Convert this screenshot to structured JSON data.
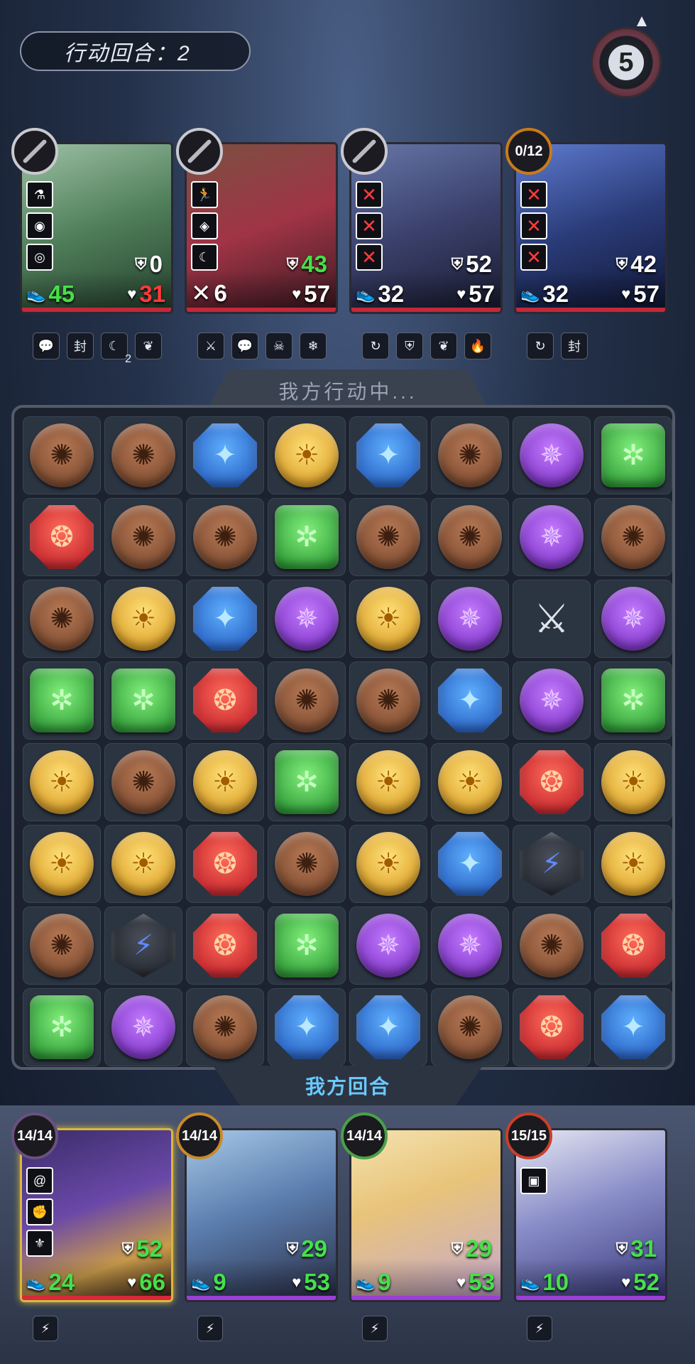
{
  "header": {
    "turn_label": "行动回合：2",
    "round_counter": "5"
  },
  "enemies": [
    {
      "badge": "",
      "speed": "45",
      "shield": "0",
      "hp": "31",
      "status_icons": [
        "flask-icon",
        "orb-icon",
        "target-icon"
      ],
      "skills": [
        "chat-icon",
        "seal-icon",
        "moon-icon",
        "leaf-icon"
      ],
      "skill_counter": "2"
    },
    {
      "badge": "",
      "speed": "6",
      "shield": "43",
      "hp": "57",
      "status_icons": [
        "runner-icon",
        "eye-icon",
        "crescent-icon"
      ],
      "skills": [
        "sword-icon",
        "chat-icon",
        "skull-icon",
        "snowflake-icon"
      ]
    },
    {
      "badge": "",
      "speed": "32",
      "shield": "52",
      "hp": "57",
      "status_icons": [
        "x-icon",
        "x-icon",
        "x-icon"
      ],
      "skills": [
        "cycle-icon",
        "shield-icon",
        "leaf-icon",
        "flame-icon"
      ]
    },
    {
      "badge": "0/12",
      "speed": "32",
      "shield": "42",
      "hp": "57",
      "status_icons": [
        "x-icon",
        "x-icon",
        "x-icon"
      ],
      "skills": [
        "cycle-icon",
        "seal-icon"
      ]
    }
  ],
  "board": {
    "header": "我方行动中...",
    "footer": "我方回合",
    "rows": [
      [
        "brown",
        "brown",
        "blue",
        "yellow",
        "blue",
        "brown",
        "purple",
        "green"
      ],
      [
        "red",
        "brown",
        "brown",
        "green",
        "brown",
        "brown",
        "purple",
        "brown"
      ],
      [
        "brown",
        "yellow",
        "blue",
        "purple",
        "yellow",
        "purple",
        "sword",
        "purple"
      ],
      [
        "green",
        "green",
        "red",
        "brown",
        "brown",
        "blue",
        "purple",
        "green"
      ],
      [
        "yellow",
        "brown",
        "yellow",
        "green",
        "yellow",
        "yellow",
        "red",
        "yellow"
      ],
      [
        "yellow",
        "yellow",
        "red",
        "brown",
        "yellow",
        "blue",
        "lightning",
        "yellow"
      ],
      [
        "brown",
        "lightning",
        "red",
        "green",
        "purple",
        "purple",
        "brown",
        "red"
      ],
      [
        "green",
        "purple",
        "brown",
        "blue",
        "blue",
        "brown",
        "red",
        "blue"
      ]
    ]
  },
  "allies": [
    {
      "ring": "14/14",
      "speed": "24",
      "shield": "52",
      "hp": "66",
      "status_icons": [
        "swirl-icon",
        "fist-icon",
        "emblem-icon"
      ]
    },
    {
      "ring": "14/14",
      "speed": "9",
      "shield": "29",
      "hp": "53",
      "status_icons": []
    },
    {
      "ring": "14/14",
      "speed": "9",
      "shield": "29",
      "hp": "53",
      "status_icons": []
    },
    {
      "ring": "15/15",
      "speed": "10",
      "shield": "31",
      "hp": "52",
      "status_icons": [
        "robot-icon"
      ]
    }
  ],
  "colors": {
    "enemy_bar": "#c4283a",
    "ally_bar": "#9b3fd6",
    "speed_green": "#46e04a",
    "hp_red": "#ff3a3a"
  }
}
